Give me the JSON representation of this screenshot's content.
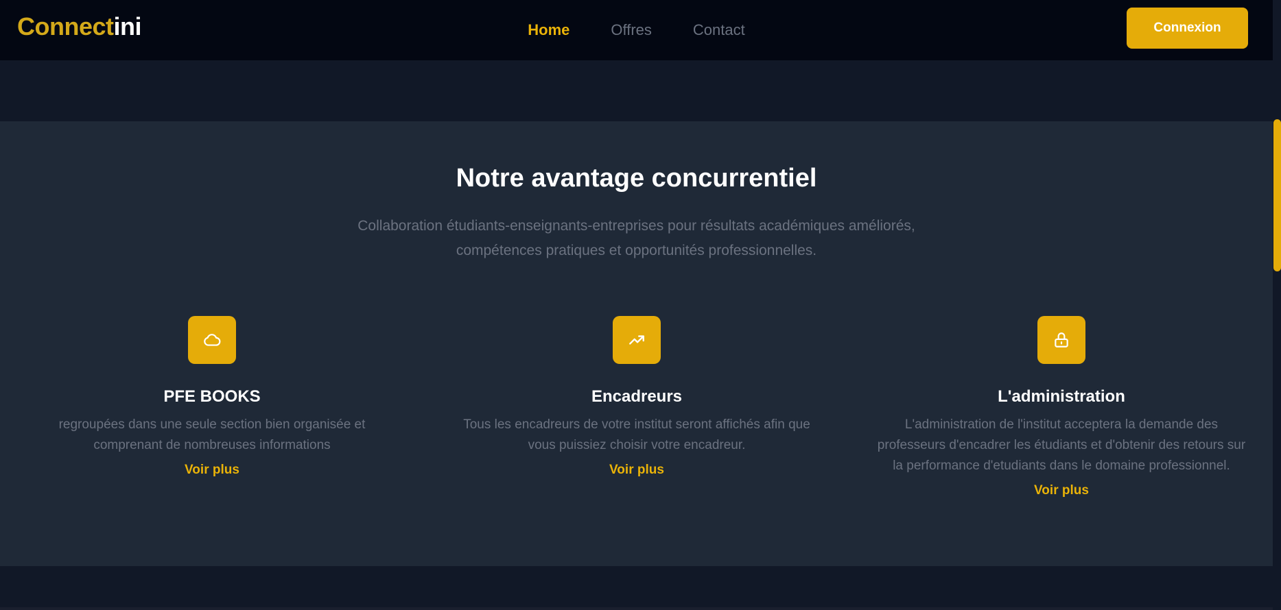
{
  "brand": {
    "part1": "Connect",
    "part2": "ini"
  },
  "nav": {
    "items": [
      {
        "label": "Home",
        "active": true
      },
      {
        "label": "Offres",
        "active": false
      },
      {
        "label": "Contact",
        "active": false
      }
    ],
    "login_label": "Connexion"
  },
  "section": {
    "title": "Notre avantage concurrentiel",
    "subtitle": "Collaboration étudiants-enseignants-entreprises pour résultats académiques améliorés, compétences pratiques et opportunités professionnelles."
  },
  "features": [
    {
      "icon": "cloud-icon",
      "title": "PFE BOOKS",
      "description": "regroupées dans une seule section bien organisée et comprenant de nombreuses informations",
      "link": "Voir plus"
    },
    {
      "icon": "trending-up-icon",
      "title": "Encadreurs",
      "description": "Tous les encadreurs de votre institut seront affichés afin que vous puissiez choisir votre encadreur.",
      "link": "Voir plus"
    },
    {
      "icon": "lock-icon",
      "title": "L'administration",
      "description": "L'administration de l'institut acceptera la demande des professeurs d'encadrer les étudiants et d'obtenir des retours sur la performance d'etudiants dans le domaine professionnel.",
      "link": "Voir plus"
    }
  ],
  "colors": {
    "accent": "#e5ac09",
    "nav_bg": "#030712",
    "section_bg": "#1f2937",
    "page_bg": "#111827"
  }
}
